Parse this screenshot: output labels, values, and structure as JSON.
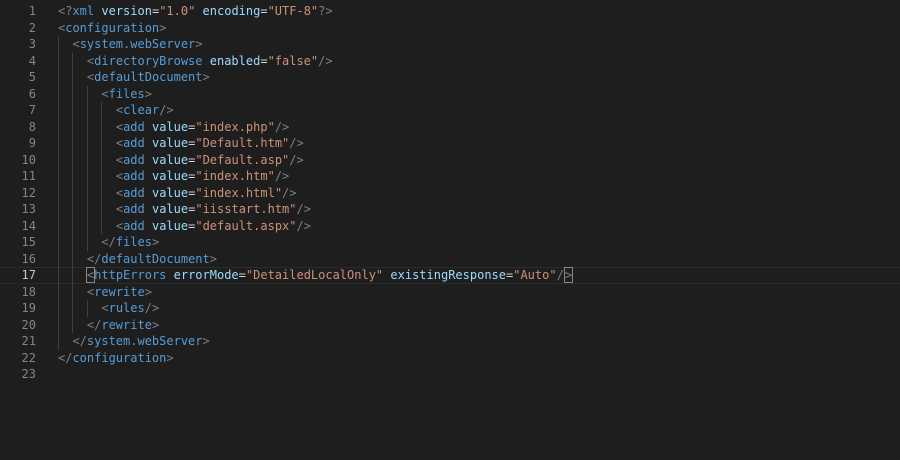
{
  "editor": {
    "language": "xml",
    "current_line": 17,
    "colors": {
      "background": "#1e1e1e",
      "line_number": "#858585",
      "punctuation": "#808080",
      "tag": "#569cd6",
      "attribute": "#9cdcfe",
      "string": "#ce9178",
      "indent_guide": "#404040"
    },
    "lines": [
      {
        "n": "1",
        "indent": 0,
        "tokens": [
          [
            "punc",
            "<?"
          ],
          [
            "tag",
            "xml"
          ],
          [
            "text",
            " "
          ],
          [
            "attr",
            "version"
          ],
          [
            "text",
            "="
          ],
          [
            "str",
            "\"1.0\""
          ],
          [
            "text",
            " "
          ],
          [
            "attr",
            "encoding"
          ],
          [
            "text",
            "="
          ],
          [
            "str",
            "\"UTF-8\""
          ],
          [
            "punc",
            "?>"
          ]
        ]
      },
      {
        "n": "2",
        "indent": 0,
        "tokens": [
          [
            "punc",
            "<"
          ],
          [
            "tag",
            "configuration"
          ],
          [
            "punc",
            ">"
          ]
        ]
      },
      {
        "n": "3",
        "indent": 1,
        "tokens": [
          [
            "punc",
            "<"
          ],
          [
            "tag",
            "system.webServer"
          ],
          [
            "punc",
            ">"
          ]
        ]
      },
      {
        "n": "4",
        "indent": 2,
        "tokens": [
          [
            "punc",
            "<"
          ],
          [
            "tag",
            "directoryBrowse"
          ],
          [
            "text",
            " "
          ],
          [
            "attr",
            "enabled"
          ],
          [
            "text",
            "="
          ],
          [
            "str",
            "\"false\""
          ],
          [
            "punc",
            "/>"
          ]
        ]
      },
      {
        "n": "5",
        "indent": 2,
        "tokens": [
          [
            "punc",
            "<"
          ],
          [
            "tag",
            "defaultDocument"
          ],
          [
            "punc",
            ">"
          ]
        ]
      },
      {
        "n": "6",
        "indent": 3,
        "tokens": [
          [
            "punc",
            "<"
          ],
          [
            "tag",
            "files"
          ],
          [
            "punc",
            ">"
          ]
        ]
      },
      {
        "n": "7",
        "indent": 4,
        "tokens": [
          [
            "punc",
            "<"
          ],
          [
            "tag",
            "clear"
          ],
          [
            "punc",
            "/>"
          ]
        ]
      },
      {
        "n": "8",
        "indent": 4,
        "tokens": [
          [
            "punc",
            "<"
          ],
          [
            "tag",
            "add"
          ],
          [
            "text",
            " "
          ],
          [
            "attr",
            "value"
          ],
          [
            "text",
            "="
          ],
          [
            "str",
            "\"index.php\""
          ],
          [
            "punc",
            "/>"
          ]
        ]
      },
      {
        "n": "9",
        "indent": 4,
        "tokens": [
          [
            "punc",
            "<"
          ],
          [
            "tag",
            "add"
          ],
          [
            "text",
            " "
          ],
          [
            "attr",
            "value"
          ],
          [
            "text",
            "="
          ],
          [
            "str",
            "\"Default.htm\""
          ],
          [
            "punc",
            "/>"
          ]
        ]
      },
      {
        "n": "10",
        "indent": 4,
        "tokens": [
          [
            "punc",
            "<"
          ],
          [
            "tag",
            "add"
          ],
          [
            "text",
            " "
          ],
          [
            "attr",
            "value"
          ],
          [
            "text",
            "="
          ],
          [
            "str",
            "\"Default.asp\""
          ],
          [
            "punc",
            "/>"
          ]
        ]
      },
      {
        "n": "11",
        "indent": 4,
        "tokens": [
          [
            "punc",
            "<"
          ],
          [
            "tag",
            "add"
          ],
          [
            "text",
            " "
          ],
          [
            "attr",
            "value"
          ],
          [
            "text",
            "="
          ],
          [
            "str",
            "\"index.htm\""
          ],
          [
            "punc",
            "/>"
          ]
        ]
      },
      {
        "n": "12",
        "indent": 4,
        "tokens": [
          [
            "punc",
            "<"
          ],
          [
            "tag",
            "add"
          ],
          [
            "text",
            " "
          ],
          [
            "attr",
            "value"
          ],
          [
            "text",
            "="
          ],
          [
            "str",
            "\"index.html\""
          ],
          [
            "punc",
            "/>"
          ]
        ]
      },
      {
        "n": "13",
        "indent": 4,
        "tokens": [
          [
            "punc",
            "<"
          ],
          [
            "tag",
            "add"
          ],
          [
            "text",
            " "
          ],
          [
            "attr",
            "value"
          ],
          [
            "text",
            "="
          ],
          [
            "str",
            "\"iisstart.htm\""
          ],
          [
            "punc",
            "/>"
          ]
        ]
      },
      {
        "n": "14",
        "indent": 4,
        "tokens": [
          [
            "punc",
            "<"
          ],
          [
            "tag",
            "add"
          ],
          [
            "text",
            " "
          ],
          [
            "attr",
            "value"
          ],
          [
            "text",
            "="
          ],
          [
            "str",
            "\"default.aspx\""
          ],
          [
            "punc",
            "/>"
          ]
        ]
      },
      {
        "n": "15",
        "indent": 3,
        "tokens": [
          [
            "punc",
            "</"
          ],
          [
            "tag",
            "files"
          ],
          [
            "punc",
            ">"
          ]
        ]
      },
      {
        "n": "16",
        "indent": 2,
        "tokens": [
          [
            "punc",
            "</"
          ],
          [
            "tag",
            "defaultDocument"
          ],
          [
            "punc",
            ">"
          ]
        ]
      },
      {
        "n": "17",
        "indent": 2,
        "tokens": [
          [
            "bracket",
            "<"
          ],
          [
            "tag",
            "httpErrors"
          ],
          [
            "text",
            " "
          ],
          [
            "attr",
            "errorMode"
          ],
          [
            "text",
            "="
          ],
          [
            "str",
            "\"DetailedLocalOnly\""
          ],
          [
            "text",
            " "
          ],
          [
            "attr",
            "existingResponse"
          ],
          [
            "text",
            "="
          ],
          [
            "str",
            "\"Auto\""
          ],
          [
            "punc",
            "/"
          ],
          [
            "cursor",
            ""
          ],
          [
            "bracket",
            ">"
          ]
        ]
      },
      {
        "n": "18",
        "indent": 2,
        "tokens": [
          [
            "punc",
            "<"
          ],
          [
            "tag",
            "rewrite"
          ],
          [
            "punc",
            ">"
          ]
        ]
      },
      {
        "n": "19",
        "indent": 3,
        "tokens": [
          [
            "punc",
            "<"
          ],
          [
            "tag",
            "rules"
          ],
          [
            "punc",
            "/>"
          ]
        ]
      },
      {
        "n": "20",
        "indent": 2,
        "tokens": [
          [
            "punc",
            "</"
          ],
          [
            "tag",
            "rewrite"
          ],
          [
            "punc",
            ">"
          ]
        ]
      },
      {
        "n": "21",
        "indent": 1,
        "tokens": [
          [
            "punc",
            "</"
          ],
          [
            "tag",
            "system.webServer"
          ],
          [
            "punc",
            ">"
          ]
        ]
      },
      {
        "n": "22",
        "indent": 0,
        "tokens": [
          [
            "punc",
            "</"
          ],
          [
            "tag",
            "configuration"
          ],
          [
            "punc",
            ">"
          ]
        ]
      },
      {
        "n": "23",
        "indent": 0,
        "tokens": []
      }
    ]
  }
}
